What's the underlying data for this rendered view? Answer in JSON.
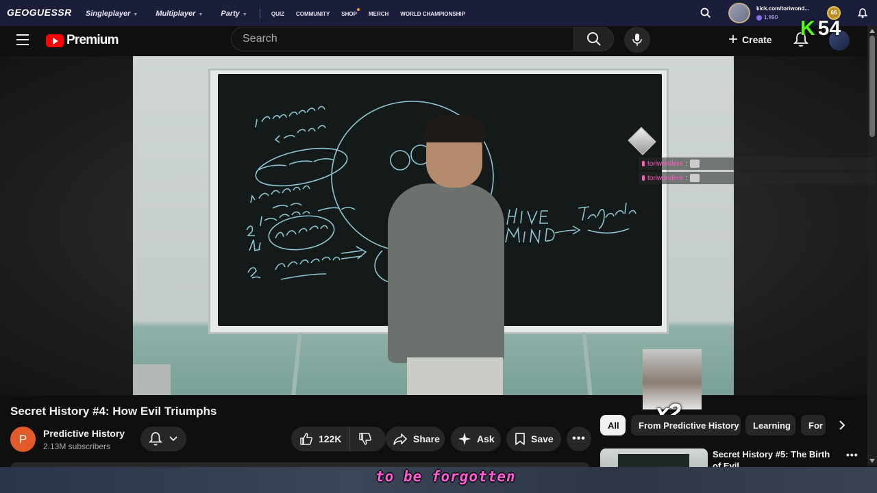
{
  "geoguessr": {
    "logo": "GEOGUESSR",
    "nav": [
      "Singleplayer",
      "Multiplayer",
      "Party"
    ],
    "links": [
      "QUIZ",
      "COMMUNITY",
      "SHOP",
      "MERCH",
      "WORLD CHAMPIONSHIP"
    ],
    "username": "kick.com/toriwond...",
    "coins": "1,890",
    "level": "66"
  },
  "kick_overlay": {
    "count": "54",
    "k": "K"
  },
  "youtube": {
    "logo_text": "Premium",
    "search_placeholder": "Search",
    "create_label": "Create"
  },
  "stream_chat": [
    {
      "user": "toriwonders",
      "sep": ":"
    },
    {
      "user": "toriwonders",
      "sep": ":"
    }
  ],
  "overlay": {
    "multiplier": "x2"
  },
  "video": {
    "title": "Secret History #4: How Evil Triumphs",
    "channel_initial": "P",
    "channel": "Predictive History",
    "subscribers": "2.13M subscribers",
    "likes": "122K",
    "share": "Share",
    "ask": "Ask",
    "save": "Save"
  },
  "chips": [
    "All",
    "From Predictive History",
    "Learning",
    "For"
  ],
  "recommended": {
    "title": "Secret History #5: The Birth of Evil"
  },
  "caption": "to be forgotten",
  "colors": {
    "kick_green": "#53fc18",
    "youtube_red": "#ff0000",
    "chat_pink": "#ff5bbf",
    "caption_pink": "#ff5bd8"
  }
}
